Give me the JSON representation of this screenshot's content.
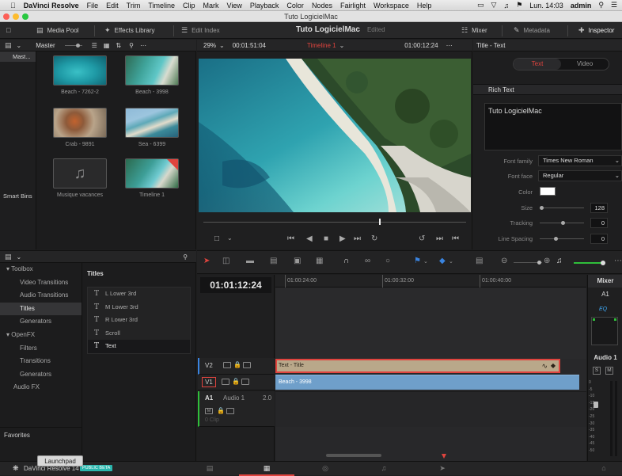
{
  "menubar": {
    "app": "DaVinci Resolve",
    "items": [
      "File",
      "Edit",
      "Trim",
      "Timeline",
      "Clip",
      "Mark",
      "View",
      "Playback",
      "Color",
      "Nodes",
      "Fairlight",
      "Workspace",
      "Help"
    ],
    "clock": "Lun. 14:03",
    "user": "admin"
  },
  "window": {
    "title": "Tuto LogicielMac"
  },
  "toolbar": {
    "media_pool": "Media Pool",
    "effects_library": "Effects Library",
    "edit_index": "Edit Index",
    "project": "Tuto LogicielMac",
    "edited": "Edited",
    "mixer": "Mixer",
    "metadata": "Metadata",
    "inspector": "Inspector"
  },
  "mediapool": {
    "bin_header": "Master",
    "master_bin": "Mast...",
    "smart_bins": "Smart Bins",
    "clips": [
      {
        "name": "Beach - 7262-2"
      },
      {
        "name": "Beach - 3998"
      },
      {
        "name": "Crab - 9891"
      },
      {
        "name": "Sea - 6399"
      },
      {
        "name": "Musique vacances"
      },
      {
        "name": "Timeline 1"
      }
    ]
  },
  "viewer": {
    "zoom": "29%",
    "source_tc": "00:01:51:04",
    "timeline_name": "Timeline 1",
    "record_tc": "01:00:12:24"
  },
  "inspector": {
    "title": "Title - Text",
    "tabs": {
      "text": "Text",
      "video": "Video"
    },
    "section": "Rich Text",
    "rich_text_value": "Tuto LogicielMac",
    "font_family_label": "Font family",
    "font_family": "Times New Roman",
    "font_face_label": "Font face",
    "font_face": "Regular",
    "color_label": "Color",
    "size_label": "Size",
    "size": "128",
    "tracking_label": "Tracking",
    "tracking": "0",
    "line_spacing_label": "Line Spacing",
    "line_spacing": "0"
  },
  "effects": {
    "tree": [
      "Toolbox",
      "Video Transitions",
      "Audio Transitions",
      "Titles",
      "Generators",
      "OpenFX",
      "Filters",
      "Transitions",
      "Generators",
      "Audio FX"
    ],
    "favorites": "Favorites",
    "titles_header": "Titles",
    "titles": [
      "L Lower 3rd",
      "M Lower 3rd",
      "R Lower 3rd",
      "Scroll",
      "Text"
    ]
  },
  "timeline": {
    "timecode": "01:01:12:24",
    "ruler": [
      "01:00:24:00",
      "01:00:32:00",
      "01:00:40:00"
    ],
    "tracks": {
      "v2": "V2",
      "v1": "V1",
      "a1": "A1",
      "a1_name": "Audio 1",
      "a1_ch": "2.0",
      "a1_clips": "0 Clip"
    },
    "clips": {
      "title": "Text - Title",
      "video": "Beach - 3998"
    }
  },
  "mixer": {
    "header": "Mixer",
    "channel": "A1",
    "eq": "EQ",
    "strip_name": "Audio 1",
    "m_btn": "M",
    "s_btn": "S",
    "scale": [
      "0",
      "-5",
      "-10",
      "-15",
      "-20",
      "-25",
      "-30",
      "-35",
      "-40",
      "-45",
      "-50"
    ]
  },
  "bottom": {
    "app": "DaVinci Resolve 14",
    "beta": "PUBLIC BETA",
    "launchpad": "Launchpad"
  },
  "colors": {
    "accent_red": "#e0443e",
    "title_clip": "#b9a88a",
    "video_clip": "#6f9fca",
    "playhead": "#e0443e"
  }
}
